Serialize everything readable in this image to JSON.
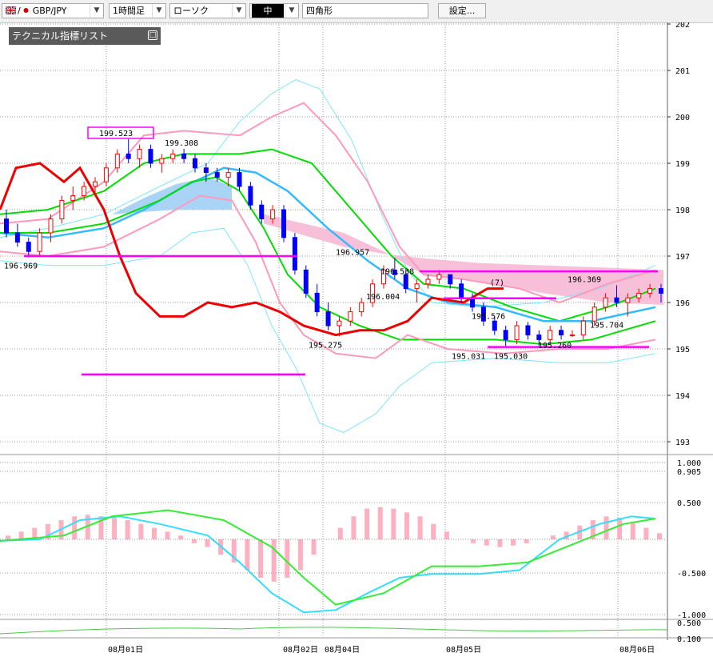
{
  "toolbar": {
    "pair": "GBP/JPY",
    "timeframe": "1時間足",
    "chart_style": "ローソク",
    "line_width": "中",
    "drawing_tool": "四角形",
    "settings_label": "設定..."
  },
  "indicator_panel": {
    "title": "テクニカル指標リスト"
  },
  "price_axis": {
    "ticks": [
      "202",
      "201",
      "200",
      "199",
      "198",
      "197",
      "196",
      "195",
      "194",
      "193"
    ]
  },
  "macd_axis": {
    "ticks": [
      "1.000",
      "0.905",
      "0.500",
      "-0.500",
      "-1.000"
    ]
  },
  "sub_axis": {
    "ticks": [
      "0.500",
      "0.100"
    ]
  },
  "date_axis": {
    "labels": [
      "08月01日",
      "08月02日",
      "08月04日",
      "08月05日",
      "08月06日"
    ]
  },
  "price_labels": [
    {
      "text": "196.969",
      "price": 196.97
    },
    {
      "text": "199.523",
      "price": 199.52
    },
    {
      "text": "199.308",
      "price": 199.31
    },
    {
      "text": "195.275",
      "price": 195.27
    },
    {
      "text": "196.957",
      "price": 196.96
    },
    {
      "text": "196.004",
      "price": 196.0
    },
    {
      "text": "196.538",
      "price": 196.54
    },
    {
      "text": "195.576",
      "price": 195.58
    },
    {
      "text": "195.031",
      "price": 195.03
    },
    {
      "text": "195.030",
      "price": 195.03
    },
    {
      "text": "195.260",
      "price": 195.26
    },
    {
      "text": "196.369",
      "price": 196.37
    },
    {
      "text": "195.704",
      "price": 195.7
    },
    {
      "text": "(7)",
      "price": 196.3
    }
  ],
  "horizontal_lines": [
    {
      "price": 197.0,
      "color": "#ff00ff"
    },
    {
      "price": 194.45,
      "color": "#ff00ff"
    },
    {
      "price": 196.67,
      "color": "#ff00ff"
    },
    {
      "price": 196.09,
      "color": "#ff00ff"
    },
    {
      "price": 195.04,
      "color": "#ff00ff"
    }
  ],
  "colors": {
    "bull_candle": "#ff0000",
    "bear_candle": "#0000ff",
    "bollinger_outer": "#7fe6ff",
    "bollinger_inner": "#ff99bb",
    "moving_average": "#00dd00",
    "ichimoku_base": "#33bbff",
    "lagging_span": "#ee0000",
    "kumo_bull": "#aad4f5",
    "kumo_bear": "#f8c0d8",
    "macd_histogram": "#ffb0c0",
    "macd_line": "#33ddff",
    "signal_line": "#33ee33"
  },
  "chart_data": {
    "type": "line",
    "ylim": [
      192.9,
      202.1
    ],
    "candles": [
      [
        197.8,
        198.0,
        197.4,
        197.5
      ],
      [
        197.5,
        197.7,
        197.2,
        197.3
      ],
      [
        197.3,
        197.4,
        196.97,
        197.1
      ],
      [
        197.1,
        197.6,
        197.0,
        197.5
      ],
      [
        197.5,
        197.9,
        197.3,
        197.8
      ],
      [
        197.8,
        198.3,
        197.7,
        198.2
      ],
      [
        198.2,
        198.5,
        198.0,
        198.3
      ],
      [
        198.3,
        198.6,
        198.2,
        198.5
      ],
      [
        198.5,
        198.7,
        198.3,
        198.6
      ],
      [
        198.6,
        199.0,
        198.5,
        198.9
      ],
      [
        198.9,
        199.3,
        198.8,
        199.2
      ],
      [
        199.2,
        199.52,
        199.0,
        199.1
      ],
      [
        199.1,
        199.4,
        198.9,
        199.3
      ],
      [
        199.3,
        199.4,
        198.9,
        199.0
      ],
      [
        199.0,
        199.2,
        198.8,
        199.1
      ],
      [
        199.1,
        199.3,
        199.0,
        199.2
      ],
      [
        199.2,
        199.31,
        199.0,
        199.1
      ],
      [
        199.1,
        199.2,
        198.8,
        198.9
      ],
      [
        198.9,
        199.0,
        198.6,
        198.8
      ],
      [
        198.8,
        198.9,
        198.6,
        198.7
      ],
      [
        198.7,
        198.9,
        198.5,
        198.8
      ],
      [
        198.8,
        198.9,
        198.4,
        198.5
      ],
      [
        198.5,
        198.6,
        198.0,
        198.1
      ],
      [
        198.1,
        198.2,
        197.7,
        197.8
      ],
      [
        197.8,
        198.1,
        197.7,
        198.0
      ],
      [
        198.0,
        198.1,
        197.3,
        197.4
      ],
      [
        197.4,
        197.5,
        196.6,
        196.7
      ],
      [
        196.7,
        196.8,
        196.1,
        196.2
      ],
      [
        196.2,
        196.4,
        195.7,
        195.8
      ],
      [
        195.8,
        196.0,
        195.4,
        195.5
      ],
      [
        195.5,
        195.7,
        195.27,
        195.6
      ],
      [
        195.6,
        195.9,
        195.5,
        195.8
      ],
      [
        195.8,
        196.1,
        195.7,
        196.0
      ],
      [
        196.0,
        196.5,
        195.9,
        196.4
      ],
      [
        196.4,
        196.8,
        196.3,
        196.7
      ],
      [
        196.7,
        196.96,
        196.5,
        196.6
      ],
      [
        196.6,
        196.7,
        196.2,
        196.3
      ],
      [
        196.3,
        196.5,
        196.0,
        196.4
      ],
      [
        196.4,
        196.6,
        196.3,
        196.5
      ],
      [
        196.5,
        196.7,
        196.4,
        196.6
      ],
      [
        196.6,
        196.54,
        196.3,
        196.4
      ],
      [
        196.4,
        196.5,
        196.0,
        196.1
      ],
      [
        196.1,
        196.2,
        195.8,
        195.9
      ],
      [
        195.9,
        196.0,
        195.5,
        195.6
      ],
      [
        195.6,
        195.7,
        195.3,
        195.4
      ],
      [
        195.4,
        195.5,
        195.03,
        195.2
      ],
      [
        195.2,
        195.6,
        195.1,
        195.5
      ],
      [
        195.5,
        195.58,
        195.2,
        195.3
      ],
      [
        195.3,
        195.4,
        195.03,
        195.2
      ],
      [
        195.2,
        195.5,
        195.1,
        195.4
      ],
      [
        195.4,
        195.5,
        195.2,
        195.3
      ],
      [
        195.3,
        195.4,
        195.26,
        195.3
      ],
      [
        195.3,
        195.7,
        195.2,
        195.6
      ],
      [
        195.6,
        196.0,
        195.5,
        195.9
      ],
      [
        195.9,
        196.2,
        195.8,
        196.1
      ],
      [
        196.1,
        196.37,
        195.9,
        196.0
      ],
      [
        196.0,
        196.2,
        195.7,
        196.1
      ],
      [
        196.1,
        196.3,
        196.0,
        196.2
      ],
      [
        196.2,
        196.4,
        196.1,
        196.3
      ],
      [
        196.3,
        196.4,
        196.0,
        196.2
      ]
    ],
    "macd_histogram": [
      0.05,
      0.1,
      0.15,
      0.2,
      0.25,
      0.3,
      0.32,
      0.3,
      0.28,
      0.25,
      0.2,
      0.15,
      0.1,
      0.05,
      -0.05,
      -0.1,
      -0.2,
      -0.3,
      -0.4,
      -0.5,
      -0.55,
      -0.5,
      -0.4,
      -0.2,
      0.0,
      0.15,
      0.3,
      0.4,
      0.42,
      0.4,
      0.35,
      0.3,
      0.2,
      0.1,
      0.0,
      -0.05,
      -0.08,
      -0.1,
      -0.08,
      -0.05,
      0.0,
      0.05,
      0.1,
      0.18,
      0.25,
      0.3,
      0.28,
      0.22,
      0.15,
      0.08
    ]
  }
}
